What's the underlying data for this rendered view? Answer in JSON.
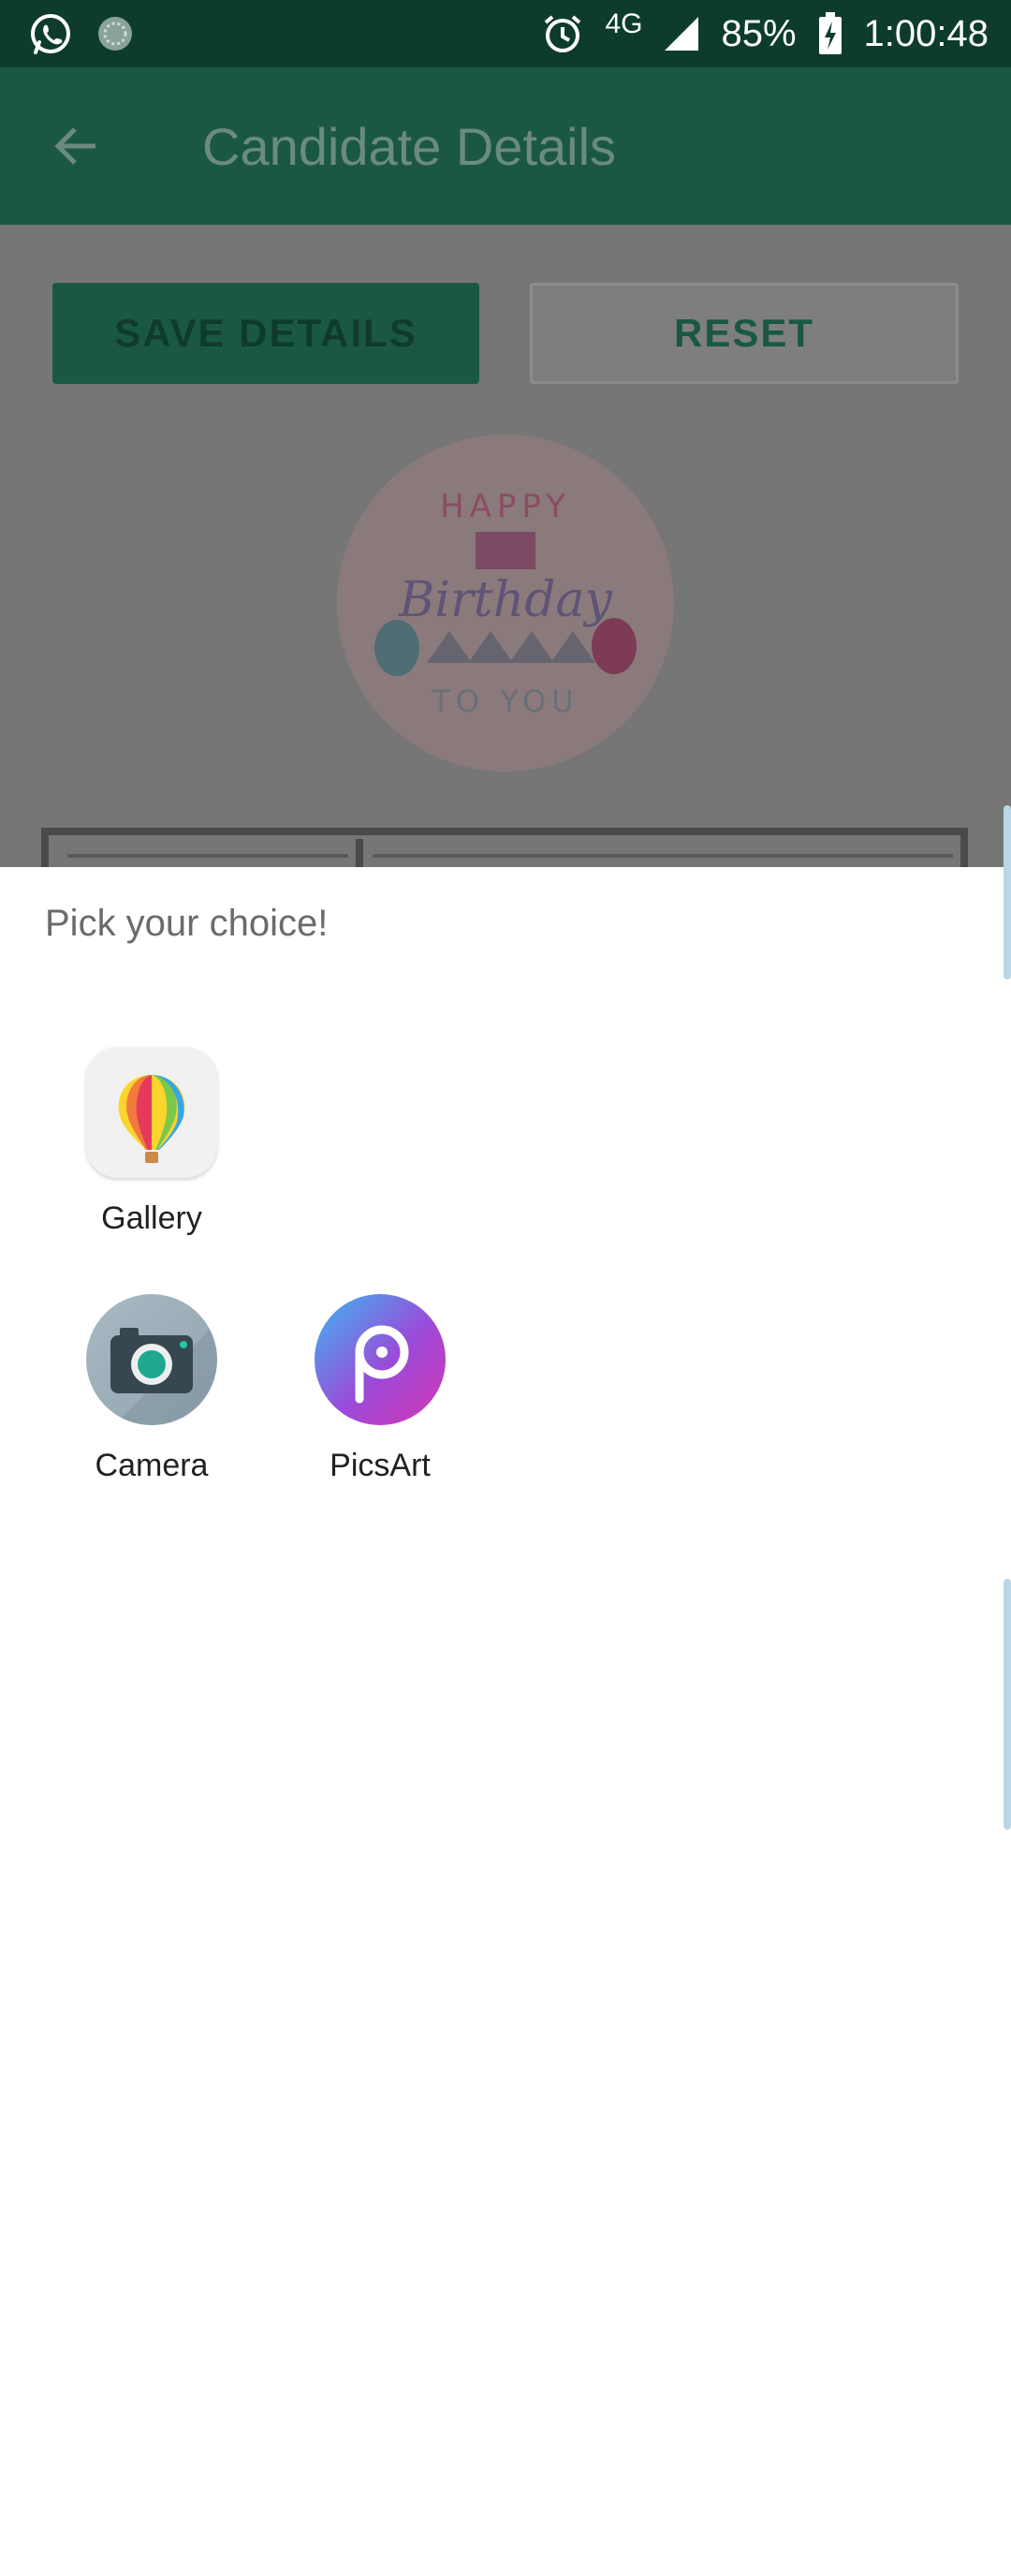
{
  "status_bar": {
    "network": "4G",
    "battery": "85%",
    "time": "1:00:48",
    "icons": [
      "whatsapp-icon",
      "sync-icon",
      "alarm-icon",
      "signal-icon",
      "battery-charging-icon"
    ]
  },
  "app_bar": {
    "title": "Candidate Details",
    "back_icon": "arrow-back-icon"
  },
  "actions": {
    "save_label": "SAVE DETAILS",
    "reset_label": "RESET"
  },
  "birthday_image": {
    "line1": "HAPPY",
    "line2": "Birthday",
    "line3": "TO YOU"
  },
  "chooser": {
    "title": "Pick your choice!",
    "apps": [
      {
        "label": "Gallery",
        "icon": "gallery-balloon-icon"
      },
      {
        "label": "Camera",
        "icon": "camera-icon"
      },
      {
        "label": "PicsArt",
        "icon": "picsart-icon"
      }
    ]
  },
  "colors": {
    "status_bar": "#0d3c2d",
    "app_bar": "#1a5845",
    "scrim": "#767676",
    "sheet": "#ffffff"
  }
}
